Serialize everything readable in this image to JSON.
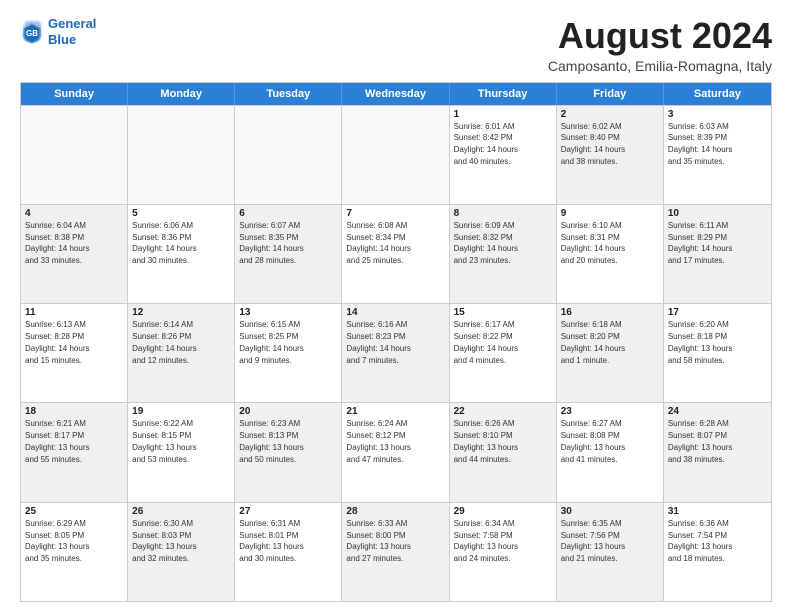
{
  "header": {
    "logo_line1": "General",
    "logo_line2": "Blue",
    "month_title": "August 2024",
    "location": "Camposanto, Emilia-Romagna, Italy"
  },
  "weekdays": [
    "Sunday",
    "Monday",
    "Tuesday",
    "Wednesday",
    "Thursday",
    "Friday",
    "Saturday"
  ],
  "rows": [
    [
      {
        "day": "",
        "info": "",
        "shaded": false,
        "empty": true
      },
      {
        "day": "",
        "info": "",
        "shaded": false,
        "empty": true
      },
      {
        "day": "",
        "info": "",
        "shaded": false,
        "empty": true
      },
      {
        "day": "",
        "info": "",
        "shaded": false,
        "empty": true
      },
      {
        "day": "1",
        "info": "Sunrise: 6:01 AM\nSunset: 8:42 PM\nDaylight: 14 hours\nand 40 minutes.",
        "shaded": false,
        "empty": false
      },
      {
        "day": "2",
        "info": "Sunrise: 6:02 AM\nSunset: 8:40 PM\nDaylight: 14 hours\nand 38 minutes.",
        "shaded": true,
        "empty": false
      },
      {
        "day": "3",
        "info": "Sunrise: 6:03 AM\nSunset: 8:39 PM\nDaylight: 14 hours\nand 35 minutes.",
        "shaded": false,
        "empty": false
      }
    ],
    [
      {
        "day": "4",
        "info": "Sunrise: 6:04 AM\nSunset: 8:38 PM\nDaylight: 14 hours\nand 33 minutes.",
        "shaded": true,
        "empty": false
      },
      {
        "day": "5",
        "info": "Sunrise: 6:06 AM\nSunset: 8:36 PM\nDaylight: 14 hours\nand 30 minutes.",
        "shaded": false,
        "empty": false
      },
      {
        "day": "6",
        "info": "Sunrise: 6:07 AM\nSunset: 8:35 PM\nDaylight: 14 hours\nand 28 minutes.",
        "shaded": true,
        "empty": false
      },
      {
        "day": "7",
        "info": "Sunrise: 6:08 AM\nSunset: 8:34 PM\nDaylight: 14 hours\nand 25 minutes.",
        "shaded": false,
        "empty": false
      },
      {
        "day": "8",
        "info": "Sunrise: 6:09 AM\nSunset: 8:32 PM\nDaylight: 14 hours\nand 23 minutes.",
        "shaded": true,
        "empty": false
      },
      {
        "day": "9",
        "info": "Sunrise: 6:10 AM\nSunset: 8:31 PM\nDaylight: 14 hours\nand 20 minutes.",
        "shaded": false,
        "empty": false
      },
      {
        "day": "10",
        "info": "Sunrise: 6:11 AM\nSunset: 8:29 PM\nDaylight: 14 hours\nand 17 minutes.",
        "shaded": true,
        "empty": false
      }
    ],
    [
      {
        "day": "11",
        "info": "Sunrise: 6:13 AM\nSunset: 8:28 PM\nDaylight: 14 hours\nand 15 minutes.",
        "shaded": false,
        "empty": false
      },
      {
        "day": "12",
        "info": "Sunrise: 6:14 AM\nSunset: 8:26 PM\nDaylight: 14 hours\nand 12 minutes.",
        "shaded": true,
        "empty": false
      },
      {
        "day": "13",
        "info": "Sunrise: 6:15 AM\nSunset: 8:25 PM\nDaylight: 14 hours\nand 9 minutes.",
        "shaded": false,
        "empty": false
      },
      {
        "day": "14",
        "info": "Sunrise: 6:16 AM\nSunset: 8:23 PM\nDaylight: 14 hours\nand 7 minutes.",
        "shaded": true,
        "empty": false
      },
      {
        "day": "15",
        "info": "Sunrise: 6:17 AM\nSunset: 8:22 PM\nDaylight: 14 hours\nand 4 minutes.",
        "shaded": false,
        "empty": false
      },
      {
        "day": "16",
        "info": "Sunrise: 6:18 AM\nSunset: 8:20 PM\nDaylight: 14 hours\nand 1 minute.",
        "shaded": true,
        "empty": false
      },
      {
        "day": "17",
        "info": "Sunrise: 6:20 AM\nSunset: 8:18 PM\nDaylight: 13 hours\nand 58 minutes.",
        "shaded": false,
        "empty": false
      }
    ],
    [
      {
        "day": "18",
        "info": "Sunrise: 6:21 AM\nSunset: 8:17 PM\nDaylight: 13 hours\nand 55 minutes.",
        "shaded": true,
        "empty": false
      },
      {
        "day": "19",
        "info": "Sunrise: 6:22 AM\nSunset: 8:15 PM\nDaylight: 13 hours\nand 53 minutes.",
        "shaded": false,
        "empty": false
      },
      {
        "day": "20",
        "info": "Sunrise: 6:23 AM\nSunset: 8:13 PM\nDaylight: 13 hours\nand 50 minutes.",
        "shaded": true,
        "empty": false
      },
      {
        "day": "21",
        "info": "Sunrise: 6:24 AM\nSunset: 8:12 PM\nDaylight: 13 hours\nand 47 minutes.",
        "shaded": false,
        "empty": false
      },
      {
        "day": "22",
        "info": "Sunrise: 6:26 AM\nSunset: 8:10 PM\nDaylight: 13 hours\nand 44 minutes.",
        "shaded": true,
        "empty": false
      },
      {
        "day": "23",
        "info": "Sunrise: 6:27 AM\nSunset: 8:08 PM\nDaylight: 13 hours\nand 41 minutes.",
        "shaded": false,
        "empty": false
      },
      {
        "day": "24",
        "info": "Sunrise: 6:28 AM\nSunset: 8:07 PM\nDaylight: 13 hours\nand 38 minutes.",
        "shaded": true,
        "empty": false
      }
    ],
    [
      {
        "day": "25",
        "info": "Sunrise: 6:29 AM\nSunset: 8:05 PM\nDaylight: 13 hours\nand 35 minutes.",
        "shaded": false,
        "empty": false
      },
      {
        "day": "26",
        "info": "Sunrise: 6:30 AM\nSunset: 8:03 PM\nDaylight: 13 hours\nand 32 minutes.",
        "shaded": true,
        "empty": false
      },
      {
        "day": "27",
        "info": "Sunrise: 6:31 AM\nSunset: 8:01 PM\nDaylight: 13 hours\nand 30 minutes.",
        "shaded": false,
        "empty": false
      },
      {
        "day": "28",
        "info": "Sunrise: 6:33 AM\nSunset: 8:00 PM\nDaylight: 13 hours\nand 27 minutes.",
        "shaded": true,
        "empty": false
      },
      {
        "day": "29",
        "info": "Sunrise: 6:34 AM\nSunset: 7:58 PM\nDaylight: 13 hours\nand 24 minutes.",
        "shaded": false,
        "empty": false
      },
      {
        "day": "30",
        "info": "Sunrise: 6:35 AM\nSunset: 7:56 PM\nDaylight: 13 hours\nand 21 minutes.",
        "shaded": true,
        "empty": false
      },
      {
        "day": "31",
        "info": "Sunrise: 6:36 AM\nSunset: 7:54 PM\nDaylight: 13 hours\nand 18 minutes.",
        "shaded": false,
        "empty": false
      }
    ]
  ]
}
